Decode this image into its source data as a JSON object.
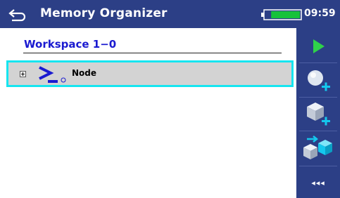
{
  "header": {
    "title": "Memory Organizer",
    "time": "09:59",
    "battery_level": 0.8
  },
  "workspace": {
    "title": "Workspace 1−0"
  },
  "tree": {
    "items": [
      {
        "label": "Node",
        "selected": true,
        "expanded": false
      }
    ]
  },
  "toolbar": {
    "buttons": [
      {
        "icon": "play-icon"
      },
      {
        "icon": "add-node-icon"
      },
      {
        "icon": "add-object-icon"
      },
      {
        "icon": "copy-structure-icon"
      }
    ],
    "more_label": "◂◂◂"
  },
  "colors": {
    "header_bg": "#2c3f86",
    "accent_blue": "#1a1ad0",
    "selection_border": "#16e5f0",
    "row_bg": "#d3d3d3",
    "play_green": "#2fd14a",
    "icon_cyan": "#14c8ee"
  }
}
